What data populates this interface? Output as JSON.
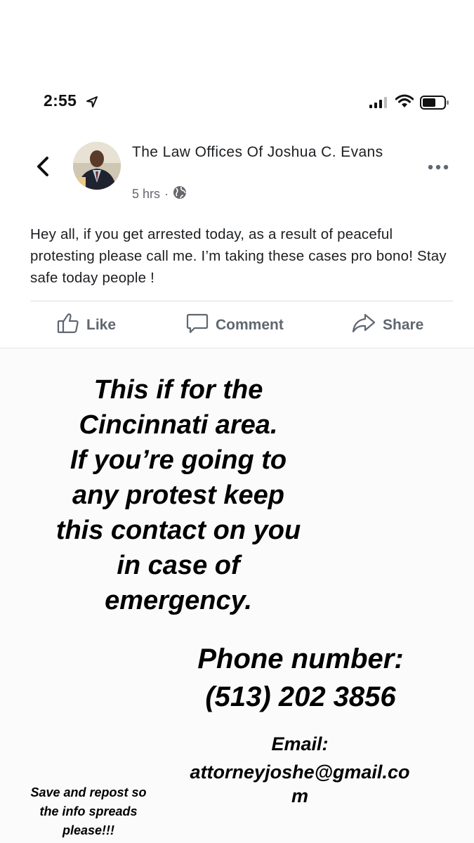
{
  "status_bar": {
    "time": "2:55",
    "location_icon": "location-arrow-icon",
    "signal_icon": "cellular-signal-icon",
    "wifi_icon": "wifi-icon",
    "battery_icon": "battery-icon"
  },
  "post": {
    "author": "The Law Offices Of Joshua C. Evans",
    "time_ago": "5 hrs",
    "separator": "·",
    "audience_icon": "globe-icon",
    "text": "Hey all, if you get arrested today, as a result of peaceful protesting please call me. I’m taking these cases pro bono! Stay safe today people !",
    "actions": {
      "like": "Like",
      "comment": "Comment",
      "share": "Share"
    }
  },
  "overlay": {
    "main_lines": [
      "This if for the",
      "Cincinnati area.",
      "If you’re going to",
      "any protest keep",
      "this contact on you",
      "in case of",
      "emergency."
    ],
    "phone_label": "Phone number:",
    "phone_number": "(513) 202 3856",
    "email_label": "Email:",
    "email_value": "attorneyjoshe@gmail.com",
    "repost_lines": [
      "Save and repost so",
      "the info spreads",
      "please!!!"
    ]
  },
  "colors": {
    "text": "#1c1e21",
    "secondary": "#65676b",
    "action": "#606770",
    "overlay_text": "#000000"
  }
}
